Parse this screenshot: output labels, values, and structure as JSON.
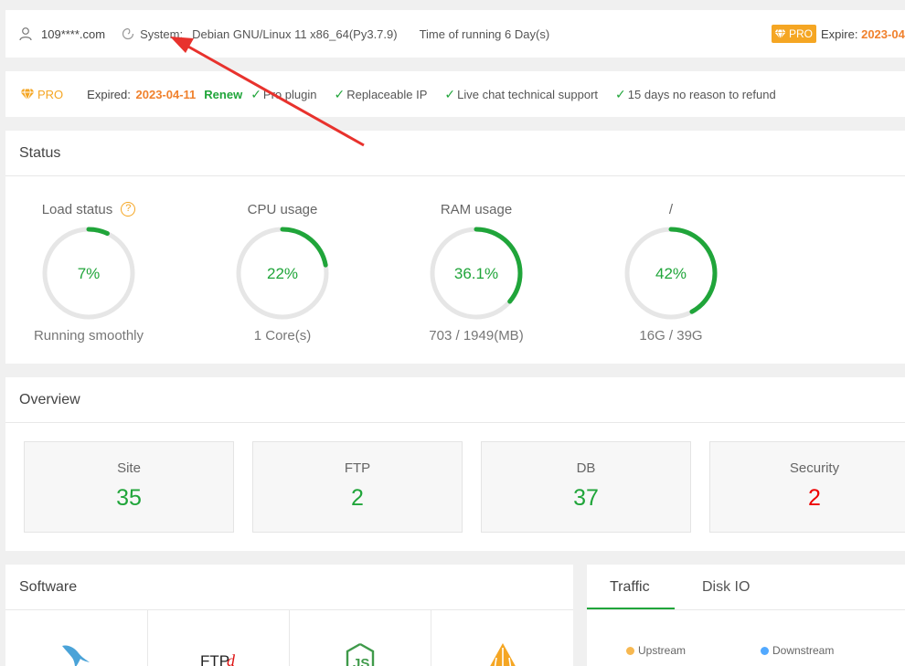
{
  "topbar": {
    "host": "109****.com",
    "system_label": "System:",
    "system_value": "Debian GNU/Linux 11 x86_64(Py3.7.9)",
    "uptime": "Time of running 6 Day(s)",
    "pro_badge": "PRO",
    "expire_label": "Expire:",
    "expire_value": "2023-04"
  },
  "probar": {
    "pro_label": "PRO",
    "expired_label": "Expired:",
    "expired_date": "2023-04-11",
    "renew": "Renew",
    "features": [
      "Pro plugin",
      "Replaceable IP",
      "Live chat technical support",
      "15 days no reason to refund"
    ]
  },
  "status": {
    "title": "Status",
    "gauges": [
      {
        "title": "Load status",
        "value": "7%",
        "percent": 7,
        "sub": "Running smoothly",
        "help": "?"
      },
      {
        "title": "CPU usage",
        "value": "22%",
        "percent": 22,
        "sub": "1 Core(s)"
      },
      {
        "title": "RAM usage",
        "value": "36.1%",
        "percent": 36.1,
        "sub": "703 / 1949(MB)"
      },
      {
        "title": "/",
        "value": "42%",
        "percent": 42,
        "sub": "16G / 39G"
      }
    ]
  },
  "overview": {
    "title": "Overview",
    "boxes": [
      {
        "label": "Site",
        "value": "35"
      },
      {
        "label": "FTP",
        "value": "2"
      },
      {
        "label": "DB",
        "value": "37"
      },
      {
        "label": "Security",
        "value": "2"
      }
    ]
  },
  "software": {
    "title": "Software",
    "icons": [
      "mysql-dolphin-icon",
      "ftp-logo-icon",
      "nodejs-icon",
      "apache-tomcat-icon"
    ]
  },
  "traffic": {
    "tabs": [
      "Traffic",
      "Disk IO"
    ],
    "legend": [
      {
        "label": "Upstream",
        "color": "#f7b851"
      },
      {
        "label": "Downstream",
        "color": "#52a9ff"
      }
    ]
  },
  "colors": {
    "accent": "#20a53a",
    "orange": "#f0812d",
    "gold": "#f5a623",
    "danger": "#ee0000",
    "arrow": "#e8322d"
  }
}
